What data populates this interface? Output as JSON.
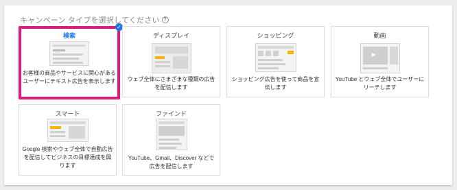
{
  "heading": "キャンペーン タイプを選択してください",
  "help_icon": "?",
  "check_icon": "✓",
  "play_icon": "▶",
  "accent_colors": {
    "selected_border": "#e0197d",
    "selected_text": "#1a73e8",
    "thumb_accent": "#f4b400"
  },
  "cards": [
    {
      "title": "検索",
      "desc": "お客様の商品やサービスに関心があるユーザーにテキスト広告を表示します",
      "selected": true
    },
    {
      "title": "ディスプレイ",
      "desc": "ウェブ全体にさまざまな種類の広告を配信します",
      "selected": false
    },
    {
      "title": "ショッピング",
      "desc": "ショッピング広告を使って商品を宣伝します",
      "selected": false
    },
    {
      "title": "動画",
      "desc": "YouTube とウェブ全体でユーザーにリーチします",
      "selected": false
    },
    {
      "title": "スマート",
      "desc": "Google 検索やウェブ全体で自動広告を配信してビジネスの目標達成を図ります",
      "selected": false
    },
    {
      "title": "ファインド",
      "desc": "YouTube、Gmail、Discover などで広告を配信します",
      "selected": false
    }
  ]
}
